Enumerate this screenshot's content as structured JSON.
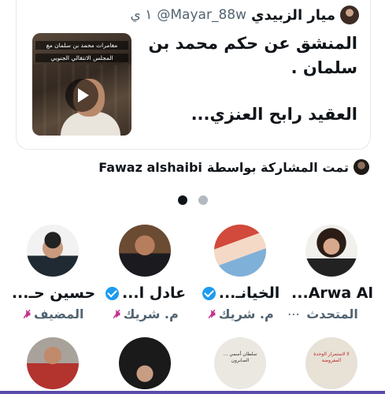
{
  "tweet": {
    "display_name": "ميار الزبيدي",
    "handle": "@Mayar_88w",
    "time": "١ ي",
    "text_line1": "المنشق عن حكم محمد بن سلمان .",
    "text_line2": "العقيد رابح العنزي...",
    "video_caption_1": "مغامرات محمد بن سلمان مع",
    "video_caption_2": "المجلس الانتقالي الجنوبي"
  },
  "shared_by": {
    "label": "تمت المشاركة بواسطة",
    "name": "Fawaz alshaibi"
  },
  "pagination": {
    "count": 2,
    "active": 0
  },
  "participants": [
    {
      "name": "Arwa Al...",
      "role": "المتحدث",
      "verified": false,
      "avatar": "woman-glasses-avatar"
    },
    {
      "name": "الخيانـ...",
      "role": "م. شريك",
      "verified": true,
      "avatar": "flag-avatar"
    },
    {
      "name": "عادل ا...",
      "role": "م. شريك",
      "verified": true,
      "avatar": "man-suit-avatar"
    },
    {
      "name": "حسين حـ...",
      "role": "المضيف",
      "verified": false,
      "avatar": "man-sunglasses-avatar"
    }
  ],
  "participants_row2": [
    {
      "avatar": "poster-red-text-avatar",
      "text": "لا لاستمرار الوحدة المفروضة"
    },
    {
      "avatar": "poster-text-avatar",
      "text": "سلطان أسمي ... الصابرون"
    },
    {
      "avatar": "dark-photo-avatar"
    },
    {
      "avatar": "man-red-sweater-avatar"
    }
  ],
  "colors": {
    "verified": "#1d9bf0",
    "mic_muted": "#c4308c",
    "secondary_text": "#536471"
  }
}
